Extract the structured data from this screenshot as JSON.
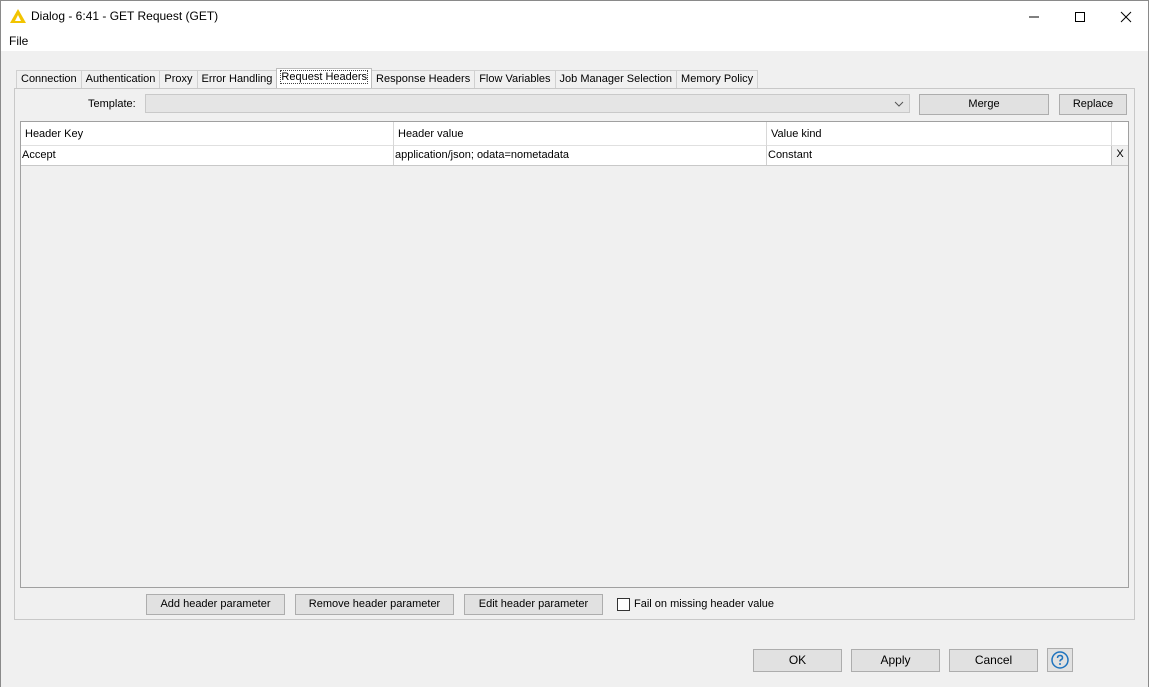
{
  "window": {
    "title": "Dialog - 6:41 - GET Request (GET)",
    "icon": "knime-triangle-icon"
  },
  "menu": {
    "file": "File"
  },
  "tabs": [
    {
      "label": "Connection"
    },
    {
      "label": "Authentication"
    },
    {
      "label": "Proxy"
    },
    {
      "label": "Error Handling"
    },
    {
      "label": "Request Headers",
      "active": true
    },
    {
      "label": "Response Headers"
    },
    {
      "label": "Flow Variables"
    },
    {
      "label": "Job Manager Selection"
    },
    {
      "label": "Memory Policy"
    }
  ],
  "template": {
    "label": "Template:",
    "value": "",
    "merge": "Merge",
    "replace": "Replace"
  },
  "table": {
    "headers": [
      "Header Key",
      "Header value",
      "Value kind"
    ],
    "rows": [
      {
        "key": "Accept",
        "value": "application/json; odata=nometadata",
        "kind": "Constant",
        "remove": "X"
      }
    ]
  },
  "actions": {
    "add": "Add header parameter",
    "remove": "Remove header parameter",
    "edit": "Edit header parameter",
    "fail_missing": "Fail on missing header value",
    "fail_missing_checked": false
  },
  "footer": {
    "ok": "OK",
    "apply": "Apply",
    "cancel": "Cancel",
    "help_icon": "help-icon"
  },
  "colors": {
    "icon_yellow": "#f2c400",
    "help_blue": "#1e73be"
  }
}
